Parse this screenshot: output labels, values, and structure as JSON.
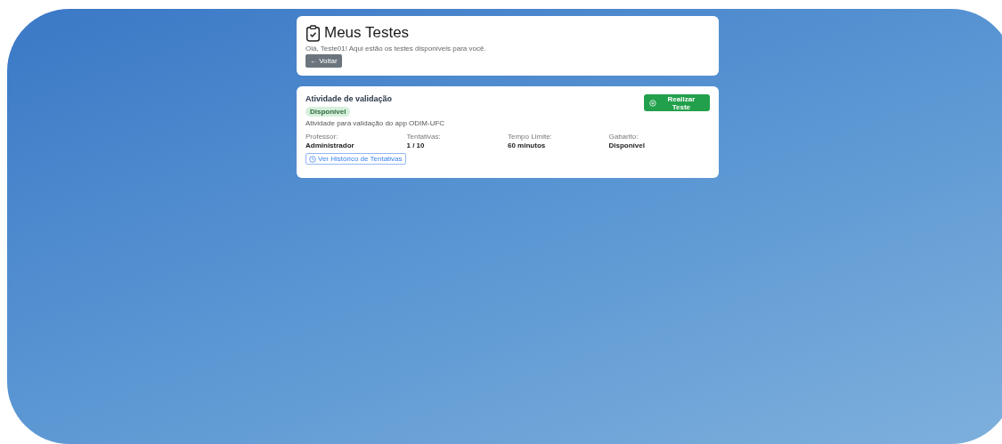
{
  "header": {
    "title": "Meus Testes",
    "subtitle": "Olá, Teste01! Aqui estão os testes disponíveis para você.",
    "back_button": "← Voltar"
  },
  "tests": [
    {
      "title": "Atividade de validação",
      "status": "Disponível",
      "available": true,
      "description": "Atividade para validação do app ODIM-UFC",
      "action": "Realizar Teste",
      "details": [
        {
          "label": "Professor:",
          "value": "Administrador"
        },
        {
          "label": "Tentativas:",
          "value": "1 / 10"
        },
        {
          "label": "Tempo Limite:",
          "value": "60 minutos"
        },
        {
          "label": "Gabarito:",
          "value": "Disponível"
        }
      ],
      "history_link": "Ver Histórico de Tentativas"
    }
  ]
}
